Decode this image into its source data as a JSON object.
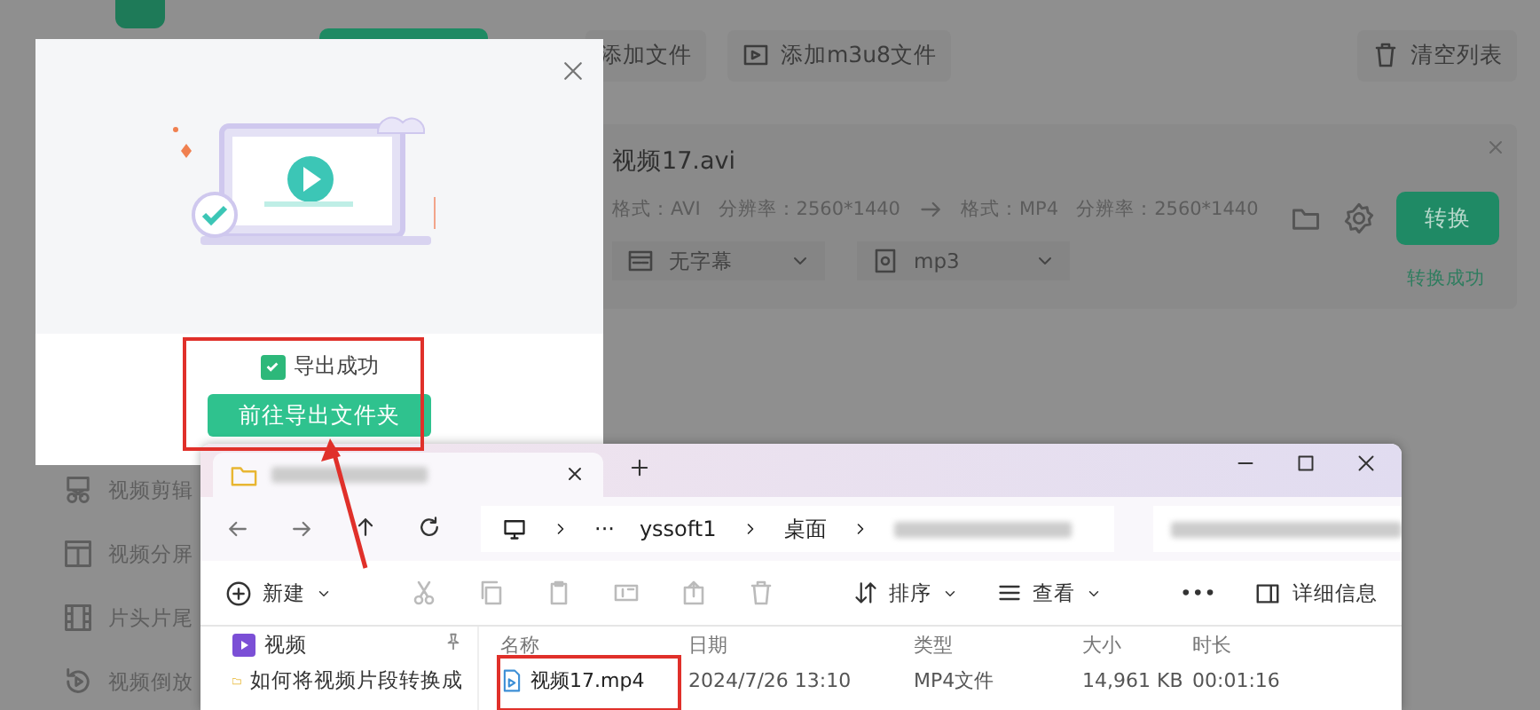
{
  "app": {
    "sidebar": [
      {
        "label": "视频剪辑"
      },
      {
        "label": "视频分屏"
      },
      {
        "label": "片头片尾"
      },
      {
        "label": "视频倒放"
      }
    ],
    "toolbar": {
      "add_file": "添加文件",
      "add_m3u8": "添加m3u8文件",
      "clear": "清空列表"
    },
    "file": {
      "name": "视频17.avi",
      "source_format": "格式：AVI",
      "source_resolution": "分辨率：2560*1440",
      "target_format": "格式：MP4",
      "target_resolution": "分辨率：2560*1440",
      "subtitle": "无字幕",
      "audio": "mp3",
      "convert_button": "转换",
      "status": "转换成功"
    }
  },
  "dialog": {
    "checked": true,
    "status": "导出成功",
    "button": "前往导出文件夹"
  },
  "explorer": {
    "path": [
      "yssoft1",
      "桌面"
    ],
    "more_path": "···",
    "toolbar": {
      "new": "新建",
      "sort": "排序",
      "view": "查看",
      "more": "•••",
      "details": "详细信息"
    },
    "nav": [
      {
        "label": "视频",
        "pinned": true
      },
      {
        "label": "如何将视频片段转换成",
        "pinned": false
      }
    ],
    "columns": [
      "名称",
      "日期",
      "类型",
      "大小",
      "时长"
    ],
    "rows": [
      {
        "cells": [
          "视频17.mp4",
          "2024/7/26 13:10",
          "MP4文件",
          "14,961 KB",
          "00:01:16"
        ]
      }
    ]
  }
}
